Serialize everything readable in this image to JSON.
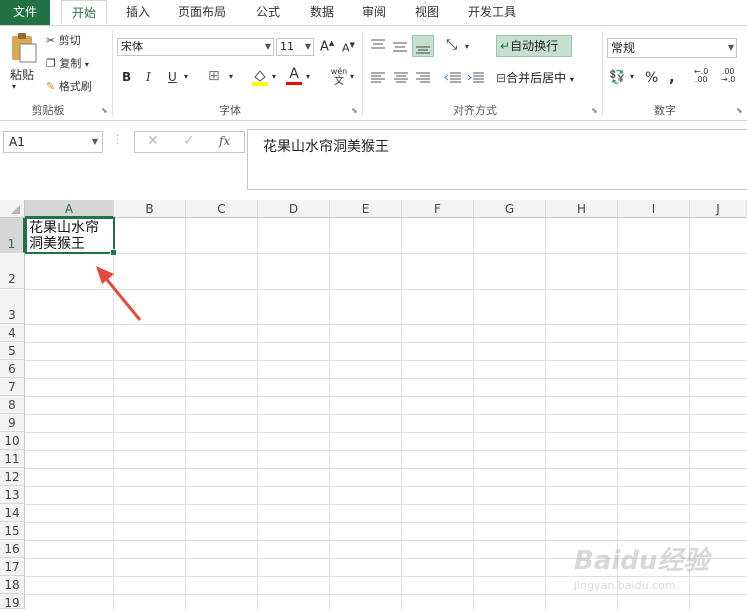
{
  "tabs": [
    "文件",
    "开始",
    "插入",
    "页面布局",
    "公式",
    "数据",
    "审阅",
    "视图",
    "开发工具"
  ],
  "clipboard": {
    "paste": "粘贴",
    "cut": "剪切",
    "copy": "复制",
    "format_painter": "格式刷",
    "group": "剪贴板"
  },
  "font": {
    "name": "宋体",
    "size": "11",
    "group": "字体",
    "bold": "B",
    "italic": "I",
    "underline": "U",
    "font_color_letter": "A",
    "pinyin_top": "wén",
    "pinyin_bottom": "文"
  },
  "alignment": {
    "wrap_text": "自动换行",
    "merge_center": "合并后居中",
    "group": "对齐方式"
  },
  "number": {
    "format": "常规",
    "percent": "%",
    "comma": ",",
    "group": "数字"
  },
  "formula_bar": {
    "name_box": "A1",
    "fx": "fx",
    "content": "花果山水帘洞美猴王"
  },
  "columns": [
    "A",
    "B",
    "C",
    "D",
    "E",
    "F",
    "G",
    "H",
    "I",
    "J"
  ],
  "rows": [
    "1",
    "2",
    "3",
    "4",
    "5",
    "6",
    "7",
    "8",
    "9",
    "10",
    "11",
    "12",
    "13",
    "14",
    "15",
    "16",
    "17",
    "18",
    "19"
  ],
  "cell_a1": {
    "line1": "花果山水帘",
    "line2": "洞美猴王"
  },
  "watermark": {
    "brand": "Baidu经验",
    "url": "jingyan.baidu.com"
  },
  "colors": {
    "excel_green": "#217346",
    "selection": "#217346",
    "arrow": "#e8473e",
    "header_bg": "#f3f3f3"
  }
}
